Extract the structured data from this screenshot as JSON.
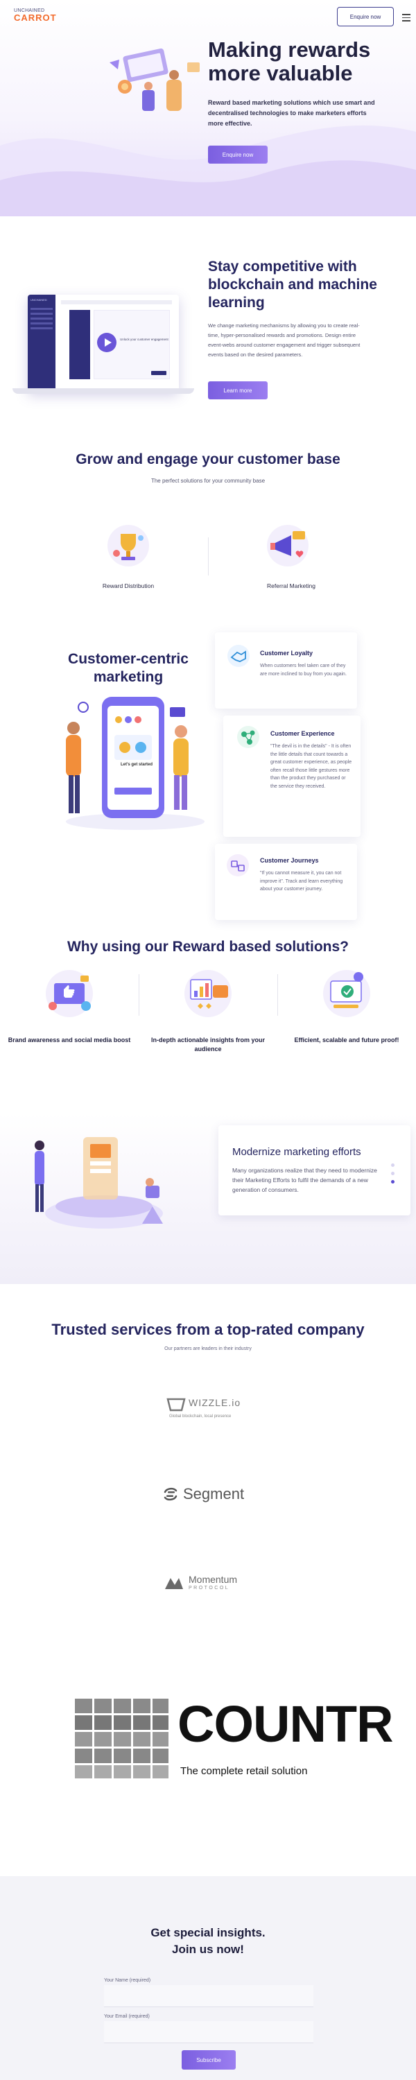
{
  "header": {
    "logo_top": "UNCHAINED",
    "logo_bottom": "CARROT",
    "enquire_label": "Enquire now"
  },
  "hero": {
    "title": "Making rewards more valuable",
    "description": "Reward based marketing solutions which use smart and decentralised technologies to make marketers efforts more effective.",
    "button_label": "Enquire now"
  },
  "competitive": {
    "title": "Stay competitive with blockchain and machine learning",
    "description": "We change marketing mechanisms by allowing you to create real-time, hyper-personalised rewards and promotions. Design entire event-webs around customer engagement and trigger subsequent events based on the desired parameters.",
    "button_label": "Learn more",
    "screen": {
      "brand": "UNCHAINED",
      "video_caption": "Unlock your customer engagement"
    }
  },
  "engage": {
    "title": "Grow and engage your customer base",
    "subtitle": "The perfect solutions for your community base",
    "features": [
      {
        "label": "Reward Distribution",
        "icon": "trophy-icon"
      },
      {
        "label": "Referral Marketing",
        "icon": "megaphone-icon"
      }
    ]
  },
  "customer_centric": {
    "title": "Customer-centric marketing",
    "phone_caption": "Let's get started",
    "cards": [
      {
        "title": "Customer Loyalty",
        "text": "When customers feel taken care of they are more inclined to buy from you again.",
        "icon": "handshake-icon"
      },
      {
        "title": "Customer Experience",
        "text": "\"The devil is in the details\" - It is often the little details that count towards a great customer experience, as people often recall those little gestures more than the product they purchased or the service they received.",
        "icon": "network-icon"
      },
      {
        "title": "Customer Journeys",
        "text": "\"If you cannot measure it, you can not improve it\". Track and learn everything about your customer journey.",
        "icon": "journey-icon"
      }
    ]
  },
  "why": {
    "title": "Why using our Reward based solutions?",
    "items": [
      {
        "label": "Brand awareness and social media boost",
        "icon": "social-like-icon"
      },
      {
        "label": "In-depth actionable insights from your audience",
        "icon": "insights-chart-icon"
      },
      {
        "label": "Efficient, scalable and future proof!",
        "icon": "scalable-check-icon"
      }
    ]
  },
  "modernize": {
    "title": "Modernize marketing efforts",
    "text": "Many organizations realize that they need to modernize their Marketing Efforts to fulfil the demands of a new generation of consumers."
  },
  "trusted": {
    "title": "Trusted services from a top-rated company",
    "subtitle": "Our partners are leaders in their industry",
    "partners": [
      {
        "name": "WIZZLE.io",
        "tagline": "Global blockchain, local presence"
      },
      {
        "name": "Segment"
      },
      {
        "name": "Momentum",
        "tagline": "PROTOCOL"
      },
      {
        "name": "COUNTR",
        "tagline": "The complete retail solution"
      }
    ]
  },
  "signup": {
    "title_line1": "Get special insights.",
    "title_line2": "Join us now!",
    "name_label": "Your Name (required)",
    "email_label": "Your Email (required)",
    "button_label": "Subscribe"
  },
  "colors": {
    "accent": "#7b5fe0",
    "navy": "#24245e",
    "logo_orange": "#f26a2b"
  }
}
